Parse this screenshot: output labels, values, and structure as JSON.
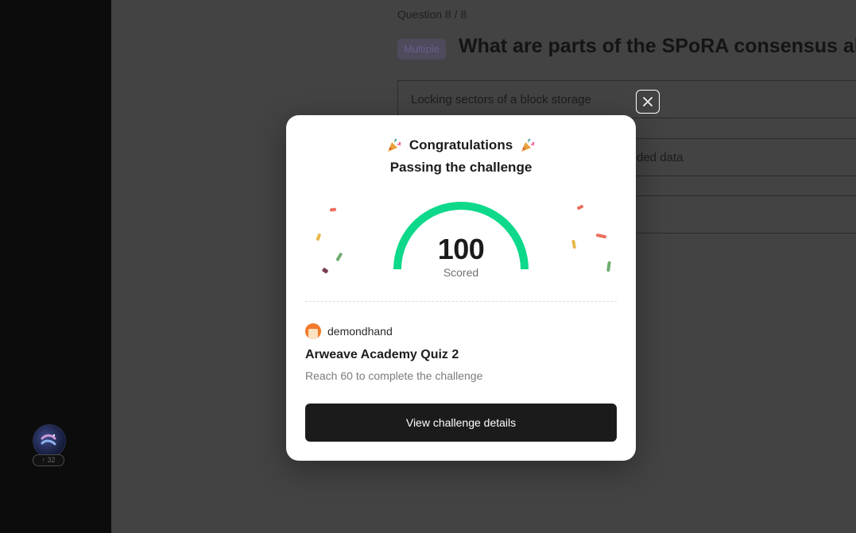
{
  "background": {
    "question_counter": "Question 8 / 8",
    "question_type_tag": "Multiple",
    "question_title": "What are parts of the SPoRA consensus algo",
    "answers": [
      "Locking sectors of a block storage",
      "ded data",
      ""
    ],
    "sidebar_badge": "↑ 32"
  },
  "modal": {
    "congrats_title": "Congratulations",
    "congrats_icon": "party-popper-icon",
    "subtitle": "Passing the challenge",
    "score": "100",
    "score_label": "Scored",
    "score_fraction": 1.0,
    "username": "demondhand",
    "challenge_title": "Arweave Academy Quiz 2",
    "challenge_description": "Reach 60 to complete the challenge",
    "details_button_label": "View challenge details",
    "close_icon": "close-icon"
  },
  "colors": {
    "gauge": "#0ed98a",
    "button_bg": "#1b1b1b",
    "overlay": "#434343",
    "confetti": [
      "#ec6f5c",
      "#e8b94a",
      "#6fae72",
      "#7a3b4e"
    ]
  }
}
